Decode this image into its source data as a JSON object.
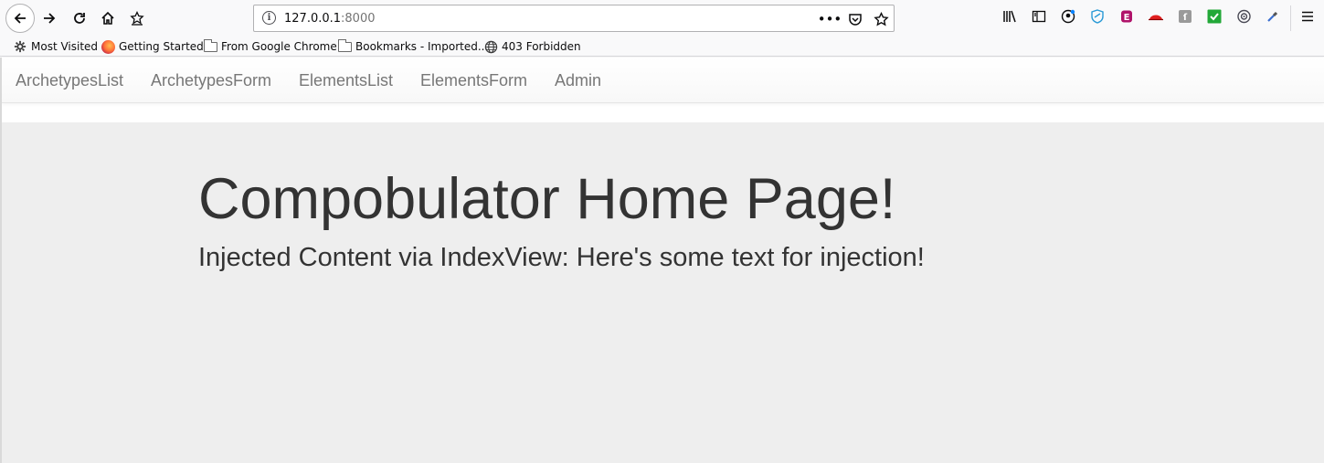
{
  "browser": {
    "url_host": "127.0.0.1",
    "url_port": ":8000",
    "nav_icons": [
      "back-icon",
      "forward-icon",
      "reload-icon",
      "home-icon",
      "bookmark-star-icon"
    ],
    "url_icons": [
      "page-actions-icon",
      "pocket-icon",
      "star-icon"
    ],
    "extension_icons": [
      "library-icon",
      "sidebar-icon",
      "account-icon",
      "shield-icon",
      "extension-e-icon",
      "redhat-icon",
      "extension-n-icon",
      "checkmark-icon",
      "reader-icon",
      "eyedropper-icon",
      "menu-icon"
    ]
  },
  "bookmarks": [
    {
      "label": "Most Visited",
      "icon": "gear-icon"
    },
    {
      "label": "Getting Started",
      "icon": "firefox-icon"
    },
    {
      "label": "From Google Chrome",
      "icon": "folder-icon"
    },
    {
      "label": "Bookmarks - Imported...",
      "icon": "folder-icon"
    },
    {
      "label": "403 Forbidden",
      "icon": "globe-icon"
    }
  ],
  "navbar": {
    "links": [
      "ArchetypesList",
      "ArchetypesForm",
      "ElementsList",
      "ElementsForm",
      "Admin"
    ]
  },
  "jumbotron": {
    "title": "Compobulator Home Page!",
    "subtitle": "Injected Content via IndexView: Here's some text for injection!"
  },
  "colors": {
    "jumbotron_bg": "#eeeeee",
    "nav_link": "#777777",
    "heading_text": "#333333"
  }
}
